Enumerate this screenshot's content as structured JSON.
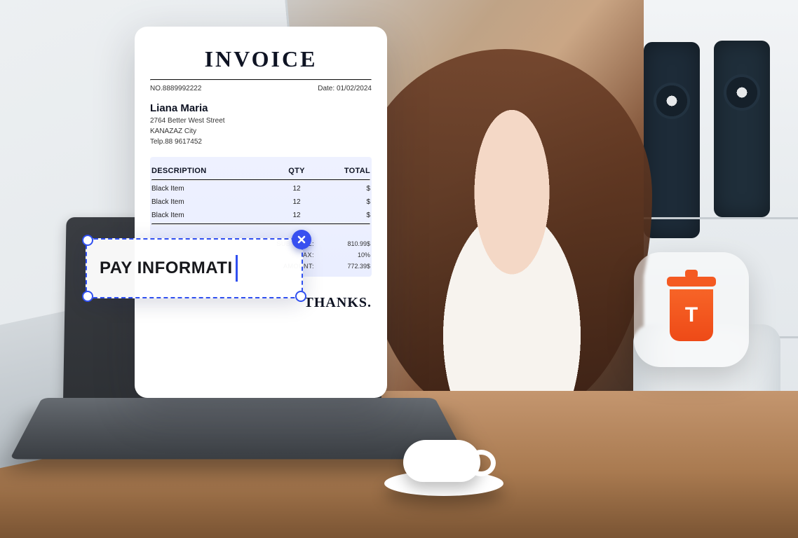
{
  "invoice": {
    "title": "INVOICE",
    "number_label": "NO.",
    "number": "8889992222",
    "date_label": "Date:",
    "date": "01/02/2024",
    "bill_to": {
      "name": "Liana Maria",
      "street": "2764 Better West Street",
      "city": "KANAZAZ City",
      "phone": "Telp.88 9617452"
    },
    "columns": {
      "desc": "DESCRIPTION",
      "qty": "QTY",
      "total": "TOTAL"
    },
    "items": [
      {
        "desc": "Black Item",
        "qty": "12",
        "total": "$"
      },
      {
        "desc": "Black Item",
        "qty": "12",
        "total": "$"
      },
      {
        "desc": "Black Item",
        "qty": "12",
        "total": "$"
      }
    ],
    "summary": {
      "subtotal_label": "SUBTOTAL:",
      "subtotal": "810.99$",
      "tax_label": "TAX:",
      "tax": "10%",
      "amount_label": "AMOUNT:",
      "amount": "772.39$"
    },
    "footer": "THANKS."
  },
  "editbox": {
    "text": "PAY INFORMATI"
  },
  "badge": {
    "letter": "T",
    "icon_name": "trash-icon"
  },
  "colors": {
    "accent_blue": "#2f4ff0",
    "brand_orange": "#f45a22"
  }
}
